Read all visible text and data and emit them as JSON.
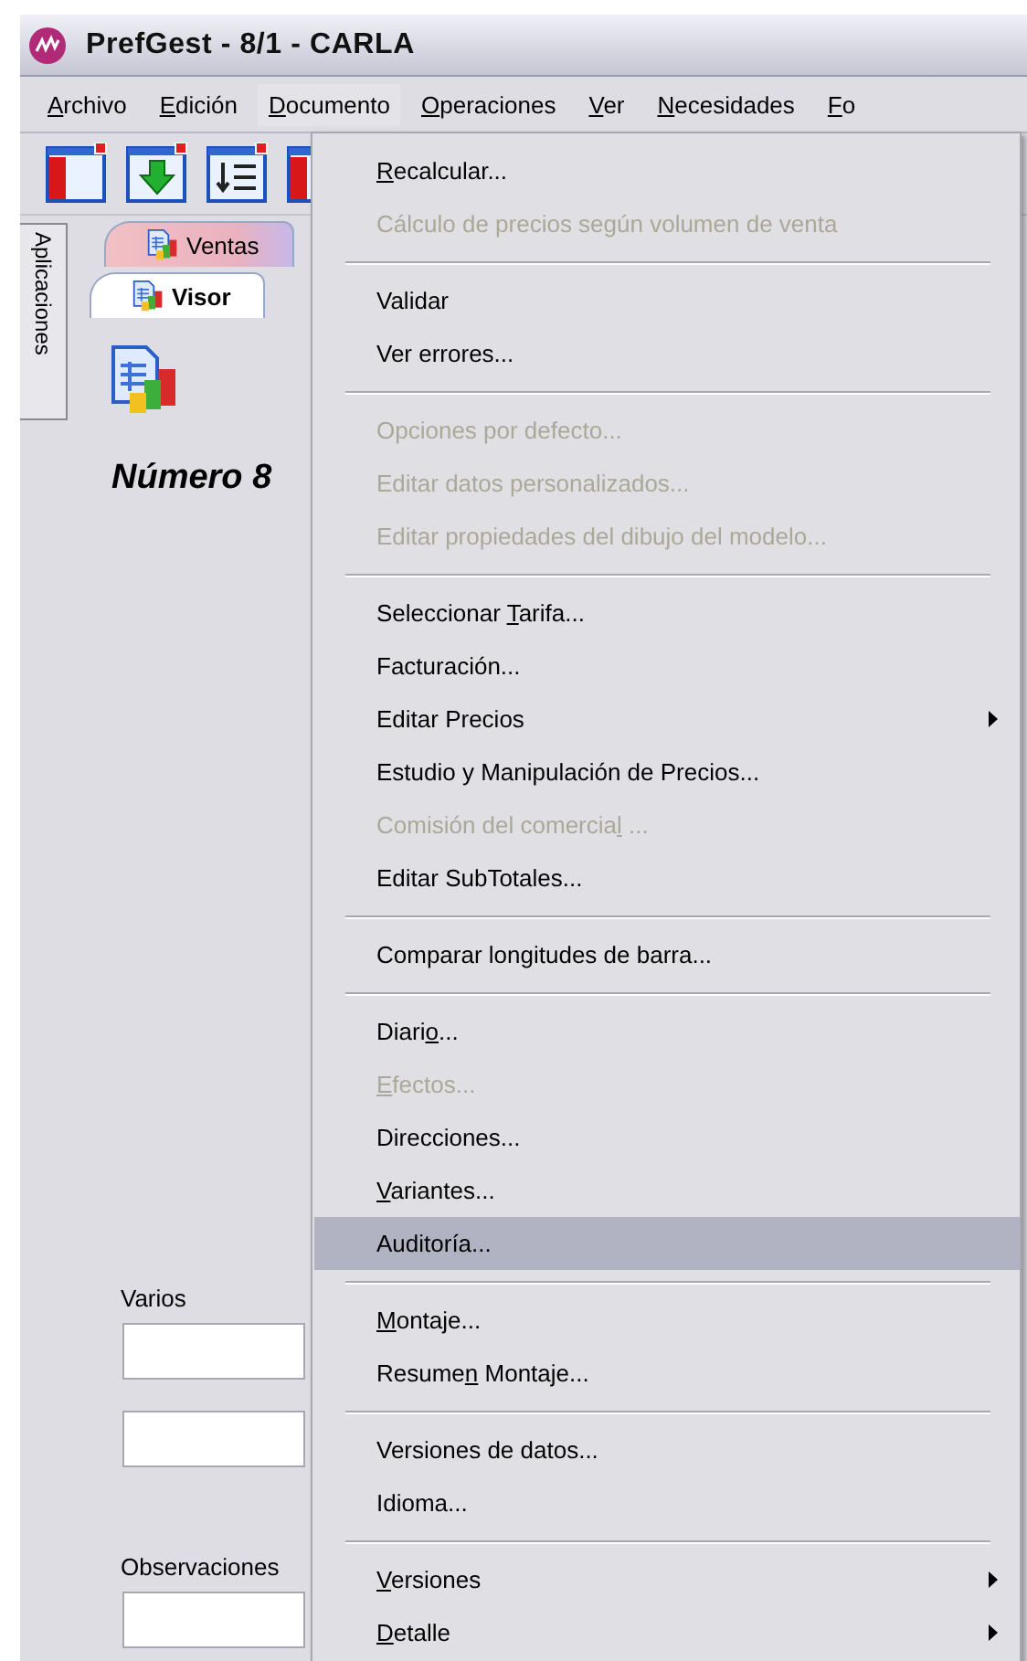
{
  "window": {
    "title": "PrefGest - 8/1 - CARLA"
  },
  "menu_bar": [
    {
      "label": {
        "key": "A",
        "after": "rchivo"
      },
      "selected": false
    },
    {
      "label": {
        "key": "E",
        "after": "dición"
      },
      "selected": false
    },
    {
      "label": {
        "key": "D",
        "after": "ocumento"
      },
      "selected": true
    },
    {
      "label": {
        "key": "O",
        "after": "peraciones"
      },
      "selected": false
    },
    {
      "label": {
        "key": "V",
        "after": "er"
      },
      "selected": false
    },
    {
      "label": {
        "key": "N",
        "after": "ecesidades"
      },
      "selected": false
    },
    {
      "label": {
        "key": "F",
        "after": "o"
      },
      "selected": false
    }
  ],
  "side_tab": {
    "label": "Aplicaciones"
  },
  "tabs": [
    {
      "label": "Ventas",
      "selected": false
    },
    {
      "label": "Visor",
      "selected": true
    }
  ],
  "document": {
    "number": "Número 8"
  },
  "form": {
    "varios_label": "Varios",
    "observaciones_label": "Observaciones"
  },
  "menu": {
    "items": [
      {
        "kind": "item",
        "label": {
          "key": "R",
          "after": "ecalcular..."
        },
        "disabled": false,
        "submenu": false,
        "selected": false
      },
      {
        "kind": "item",
        "label": {
          "before": "Cálculo de precios según volumen de venta"
        },
        "disabled": true,
        "submenu": false,
        "selected": false
      },
      {
        "kind": "separator"
      },
      {
        "kind": "item",
        "label": {
          "before": "Validar"
        },
        "disabled": false,
        "submenu": false,
        "selected": false
      },
      {
        "kind": "item",
        "label": {
          "before": "Ver errores..."
        },
        "disabled": false,
        "submenu": false,
        "selected": false
      },
      {
        "kind": "separator"
      },
      {
        "kind": "item",
        "label": {
          "before": "Opciones por defecto..."
        },
        "disabled": true,
        "submenu": false,
        "selected": false
      },
      {
        "kind": "item",
        "label": {
          "before": "Editar datos personalizados..."
        },
        "disabled": true,
        "submenu": false,
        "selected": false
      },
      {
        "kind": "item",
        "label": {
          "before": "Editar propiedades del dibujo del modelo..."
        },
        "disabled": true,
        "submenu": false,
        "selected": false
      },
      {
        "kind": "separator"
      },
      {
        "kind": "item",
        "label": {
          "before": "Seleccionar ",
          "key": "T",
          "after": "arifa..."
        },
        "disabled": false,
        "submenu": false,
        "selected": false
      },
      {
        "kind": "item",
        "label": {
          "before": "Facturación..."
        },
        "disabled": false,
        "submenu": false,
        "selected": false
      },
      {
        "kind": "item",
        "label": {
          "before": "Editar Precios"
        },
        "disabled": false,
        "submenu": true,
        "selected": false
      },
      {
        "kind": "item",
        "label": {
          "before": "Estudio y Manipulación de Precios..."
        },
        "disabled": false,
        "submenu": false,
        "selected": false
      },
      {
        "kind": "item",
        "label": {
          "before": "Comisión del comercia",
          "key": "l",
          "after": " ..."
        },
        "disabled": true,
        "submenu": false,
        "selected": false
      },
      {
        "kind": "item",
        "label": {
          "before": "Editar SubTotales..."
        },
        "disabled": false,
        "submenu": false,
        "selected": false
      },
      {
        "kind": "separator"
      },
      {
        "kind": "item",
        "label": {
          "before": "Comparar longitudes de barra..."
        },
        "disabled": false,
        "submenu": false,
        "selected": false
      },
      {
        "kind": "separator"
      },
      {
        "kind": "item",
        "label": {
          "before": "Diari",
          "key": "o",
          "after": "..."
        },
        "disabled": false,
        "submenu": false,
        "selected": false
      },
      {
        "kind": "item",
        "label": {
          "key": "E",
          "after": "fectos..."
        },
        "disabled": true,
        "submenu": false,
        "selected": false
      },
      {
        "kind": "item",
        "label": {
          "before": "Direcciones..."
        },
        "disabled": false,
        "submenu": false,
        "selected": false
      },
      {
        "kind": "item",
        "label": {
          "key": "V",
          "after": "ariantes..."
        },
        "disabled": false,
        "submenu": false,
        "selected": false
      },
      {
        "kind": "item",
        "label": {
          "before": "Auditoría..."
        },
        "disabled": false,
        "submenu": false,
        "selected": true
      },
      {
        "kind": "separator"
      },
      {
        "kind": "item",
        "label": {
          "key": "M",
          "after": "ontaje..."
        },
        "disabled": false,
        "submenu": false,
        "selected": false
      },
      {
        "kind": "item",
        "label": {
          "before": "Resume",
          "key": "n",
          "after": " Montaje..."
        },
        "disabled": false,
        "submenu": false,
        "selected": false
      },
      {
        "kind": "separator"
      },
      {
        "kind": "item",
        "label": {
          "before": "Versiones de datos..."
        },
        "disabled": false,
        "submenu": false,
        "selected": false
      },
      {
        "kind": "item",
        "label": {
          "before": "Idioma..."
        },
        "disabled": false,
        "submenu": false,
        "selected": false
      },
      {
        "kind": "separator"
      },
      {
        "kind": "item",
        "label": {
          "key": "V",
          "after": "ersiones"
        },
        "disabled": false,
        "submenu": true,
        "selected": false
      },
      {
        "kind": "item",
        "label": {
          "key": "D",
          "after": "etalle"
        },
        "disabled": false,
        "submenu": true,
        "selected": false
      }
    ]
  }
}
